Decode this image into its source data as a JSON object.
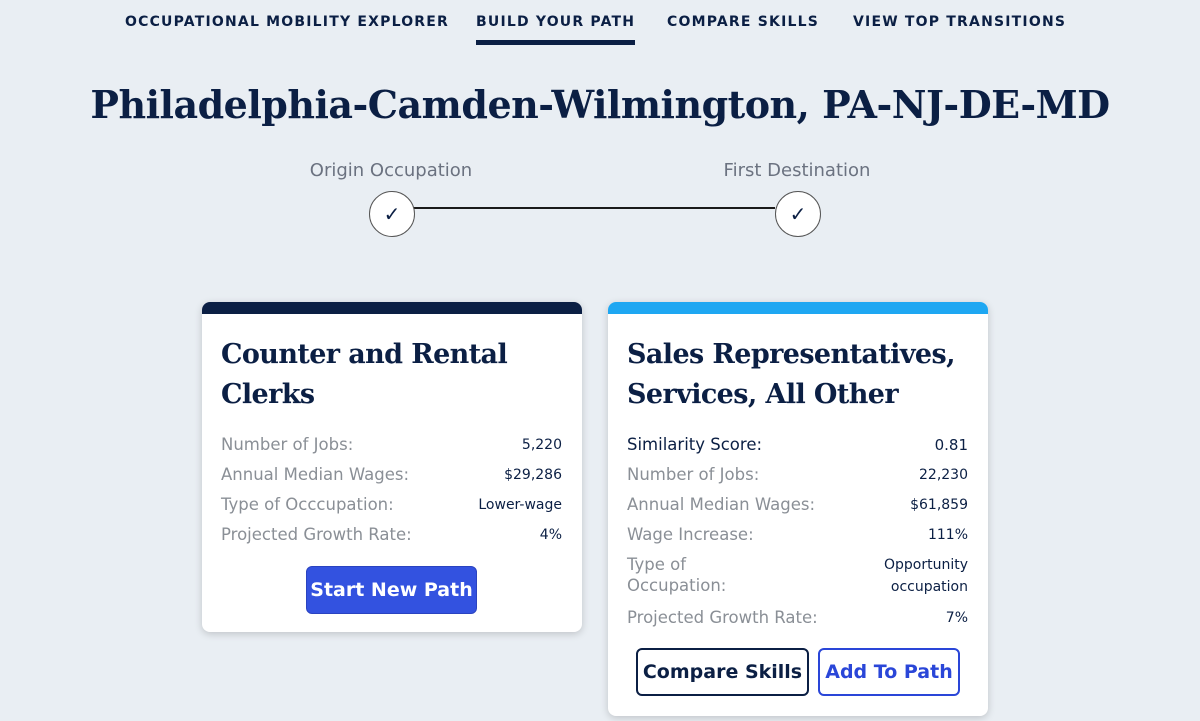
{
  "nav": {
    "items": [
      {
        "label": "OCCUPATIONAL MOBILITY EXPLORER",
        "active": false
      },
      {
        "label": "BUILD YOUR PATH",
        "active": true
      },
      {
        "label": "COMPARE SKILLS",
        "active": false
      },
      {
        "label": "VIEW TOP TRANSITIONS",
        "active": false
      }
    ]
  },
  "page_title": "Philadelphia-Camden-Wilmington, PA-NJ-DE-MD",
  "stepper": {
    "steps": [
      {
        "label": "Origin Occupation",
        "mark": "✓"
      },
      {
        "label": "First Destination",
        "mark": "✓"
      }
    ]
  },
  "origin_card": {
    "accent": "#0b1f44",
    "title_line1": "Counter and Rental",
    "title_line2": "Clerks",
    "stats": [
      {
        "label": "Number of Jobs:",
        "value": "5,220"
      },
      {
        "label": "Annual Median Wages:",
        "value": "$29,286"
      },
      {
        "label": "Type of Occcupation:",
        "value": "Lower-wage"
      },
      {
        "label": "Projected Growth Rate:",
        "value": "4%"
      }
    ],
    "button_label": "Start New Path"
  },
  "destination_card": {
    "accent": "#1ea7f2",
    "title_line1": "Sales Representatives,",
    "title_line2": "Services, All Other",
    "similarity": {
      "label": "Similarity Score:",
      "value": "0.81"
    },
    "stats": [
      {
        "label": "Number of Jobs:",
        "value": "22,230"
      },
      {
        "label": "Annual Median Wages:",
        "value": "$61,859"
      },
      {
        "label": "Wage Increase:",
        "value": "111%"
      }
    ],
    "type": {
      "label_line1": "Type of",
      "label_line2": "Occupation:",
      "value_line1": "Opportunity",
      "value_line2": "occupation"
    },
    "growth": {
      "label": "Projected Growth Rate:",
      "value": "7%"
    },
    "compare_label": "Compare Skills",
    "add_label": "Add To Path"
  }
}
